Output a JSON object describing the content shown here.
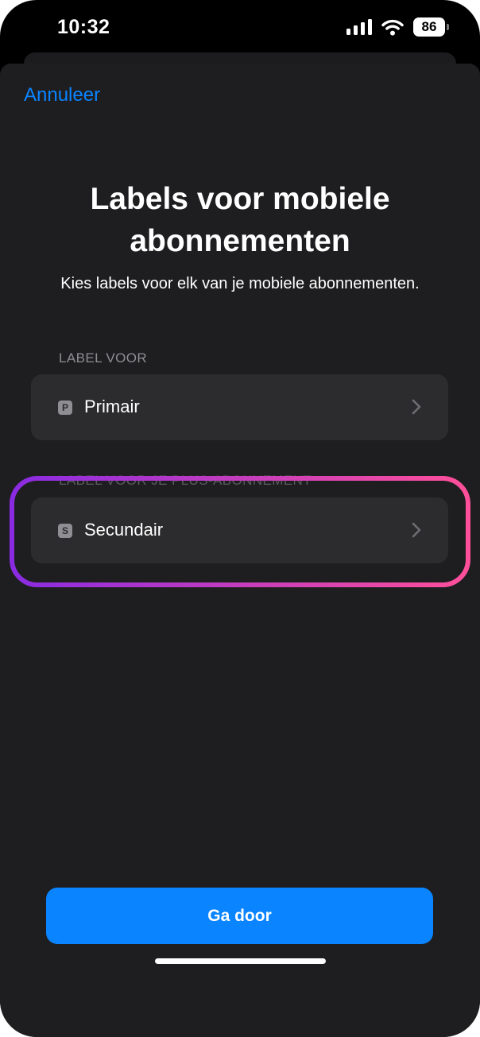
{
  "status_bar": {
    "time": "10:32",
    "battery": "86"
  },
  "nav": {
    "cancel_label": "Annuleer"
  },
  "header": {
    "title": "Labels voor mobiele abonnementen",
    "subtitle": "Kies labels voor elk van je mobiele abonnementen."
  },
  "sections": [
    {
      "header": "LABEL VOOR",
      "item": {
        "badge": "P",
        "label": "Primair"
      }
    },
    {
      "header": "LABEL VOOR JE PLUS-ABONNEMENT",
      "item": {
        "badge": "S",
        "label": "Secundair"
      }
    }
  ],
  "footer": {
    "continue_label": "Ga door"
  },
  "colors": {
    "accent": "#0a84ff",
    "highlight_gradient_start": "#8a2be2",
    "highlight_gradient_end": "#ff4f9a"
  }
}
